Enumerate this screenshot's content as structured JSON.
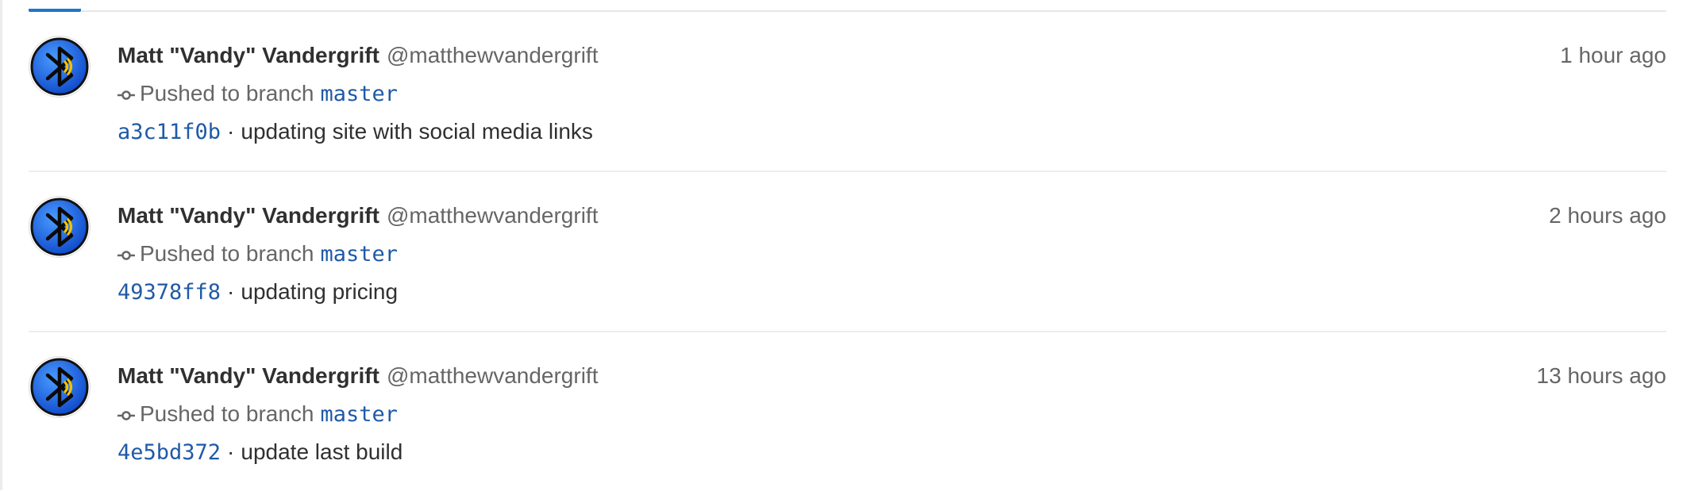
{
  "feed": {
    "events": [
      {
        "author_name": "Matt \"Vandy\" Vandergrift",
        "author_handle": "@matthewvandergrift",
        "time": "1 hour ago",
        "action": "Pushed to branch",
        "branch": "master",
        "commit_sha": "a3c11f0b",
        "separator": "·",
        "commit_message": "updating site with social media links"
      },
      {
        "author_name": "Matt \"Vandy\" Vandergrift",
        "author_handle": "@matthewvandergrift",
        "time": "2 hours ago",
        "action": "Pushed to branch",
        "branch": "master",
        "commit_sha": "49378ff8",
        "separator": "·",
        "commit_message": "updating pricing"
      },
      {
        "author_name": "Matt \"Vandy\" Vandergrift",
        "author_handle": "@matthewvandergrift",
        "time": "13 hours ago",
        "action": "Pushed to branch",
        "branch": "master",
        "commit_sha": "4e5bd372",
        "separator": "·",
        "commit_message": "update last build"
      }
    ]
  },
  "icons": {
    "avatar": "bluetooth-logo-avatar",
    "commit": "commit-icon"
  },
  "colors": {
    "link": "#1f5aa6",
    "tab_active": "#1f75cb",
    "avatar_blue": "#1f6fe0",
    "avatar_yellow": "#f2c200"
  }
}
